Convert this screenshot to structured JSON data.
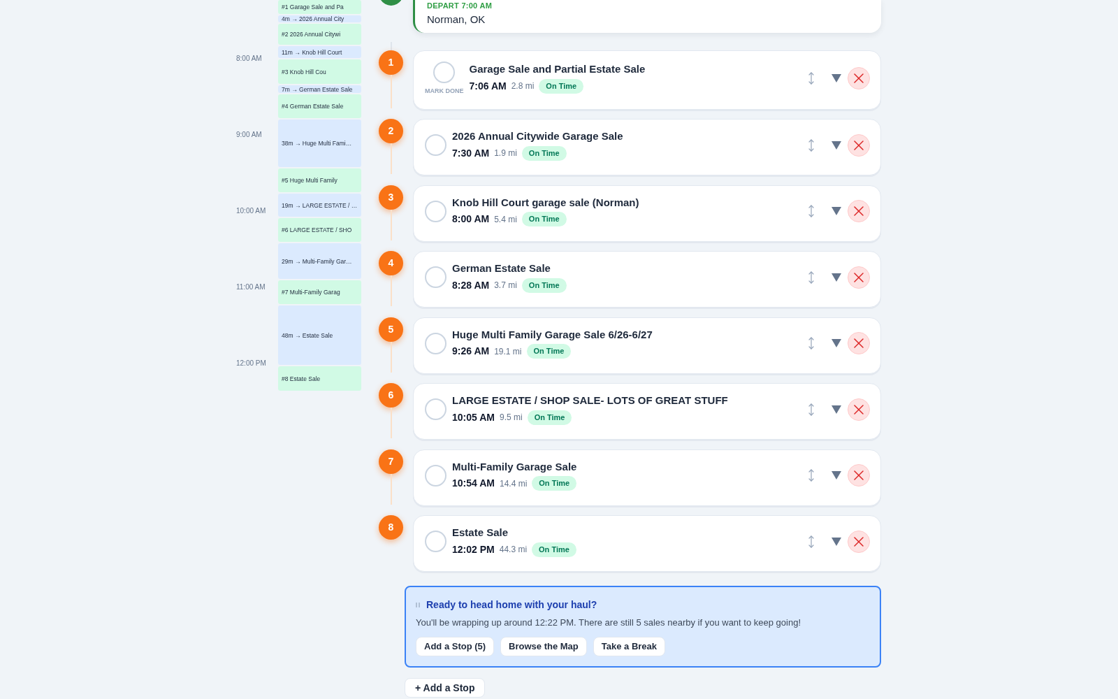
{
  "timeline": {
    "hours": [
      "8:00 AM",
      "9:00 AM",
      "10:00 AM",
      "11:00 AM",
      "12:00 PM"
    ],
    "blocks": [
      {
        "kind": "stop",
        "label": "#1 Garage Sale and Pa"
      },
      {
        "kind": "travel",
        "label": "4m → 2026 Annual City"
      },
      {
        "kind": "stop",
        "label": "#2 2026 Annual Citywi"
      },
      {
        "kind": "travel",
        "label": "11m → Knob Hill Court"
      },
      {
        "kind": "stop",
        "label": "#3 Knob Hill Cou"
      },
      {
        "kind": "travel",
        "label": "7m → German Estate Sale"
      },
      {
        "kind": "stop",
        "label": "#4 German Estate Sale"
      },
      {
        "kind": "travel",
        "label": "38m → Huge Multi Fami…"
      },
      {
        "kind": "stop",
        "label": "#5 Huge Multi Family"
      },
      {
        "kind": "travel",
        "label": "19m → LARGE ESTATE / …"
      },
      {
        "kind": "stop",
        "label": "#6 LARGE ESTATE / SHO"
      },
      {
        "kind": "travel",
        "label": "29m → Multi-Family Gar…"
      },
      {
        "kind": "stop",
        "label": "#7 Multi-Family Garag"
      },
      {
        "kind": "travel",
        "label": "48m → Estate Sale"
      },
      {
        "kind": "stop",
        "label": "#8 Estate Sale"
      }
    ]
  },
  "depart": {
    "label": "DEPART 7:00 AM",
    "place": "Norman, OK"
  },
  "stops": [
    {
      "number": "1",
      "title": "Garage Sale and Partial Estate Sale",
      "time": "7:06 AM",
      "distance": "2.8 mi",
      "status": "On Time",
      "done": false,
      "hint": "MARK DONE"
    },
    {
      "number": "2",
      "title": "2026 Annual Citywide Garage Sale",
      "time": "7:30 AM",
      "distance": "1.9 mi",
      "status": "On Time",
      "done": false
    },
    {
      "number": "3",
      "title": "Knob Hill Court garage sale (Norman)",
      "time": "8:00 AM",
      "distance": "5.4 mi",
      "status": "On Time",
      "done": false
    },
    {
      "number": "4",
      "title": "German Estate Sale",
      "time": "8:28 AM",
      "distance": "3.7 mi",
      "status": "On Time",
      "done": false
    },
    {
      "number": "5",
      "title": "Huge Multi Family Garage Sale 6/26-6/27",
      "time": "9:26 AM",
      "distance": "19.1 mi",
      "status": "On Time",
      "done": false
    },
    {
      "number": "6",
      "title": "LARGE ESTATE / SHOP SALE- LOTS OF GREAT STUFF",
      "time": "10:05 AM",
      "distance": "9.5 mi",
      "status": "On Time",
      "done": false
    },
    {
      "number": "7",
      "title": "Multi-Family Garage Sale",
      "time": "10:54 AM",
      "distance": "14.4 mi",
      "status": "On Time",
      "done": false
    },
    {
      "number": "8",
      "title": "Estate Sale",
      "time": "12:02 PM",
      "distance": "44.3 mi",
      "status": "On Time",
      "done": false
    }
  ],
  "suggestion": {
    "title": "Ready to head home with your haul?",
    "body": "You'll be wrapping up around 12:22 PM. There are still 5 sales nearby if you want to keep going!",
    "actions": [
      "Add a Stop (5)",
      "Browse the Map",
      "Take a Break"
    ]
  },
  "add_stop": "+ Add a Stop"
}
